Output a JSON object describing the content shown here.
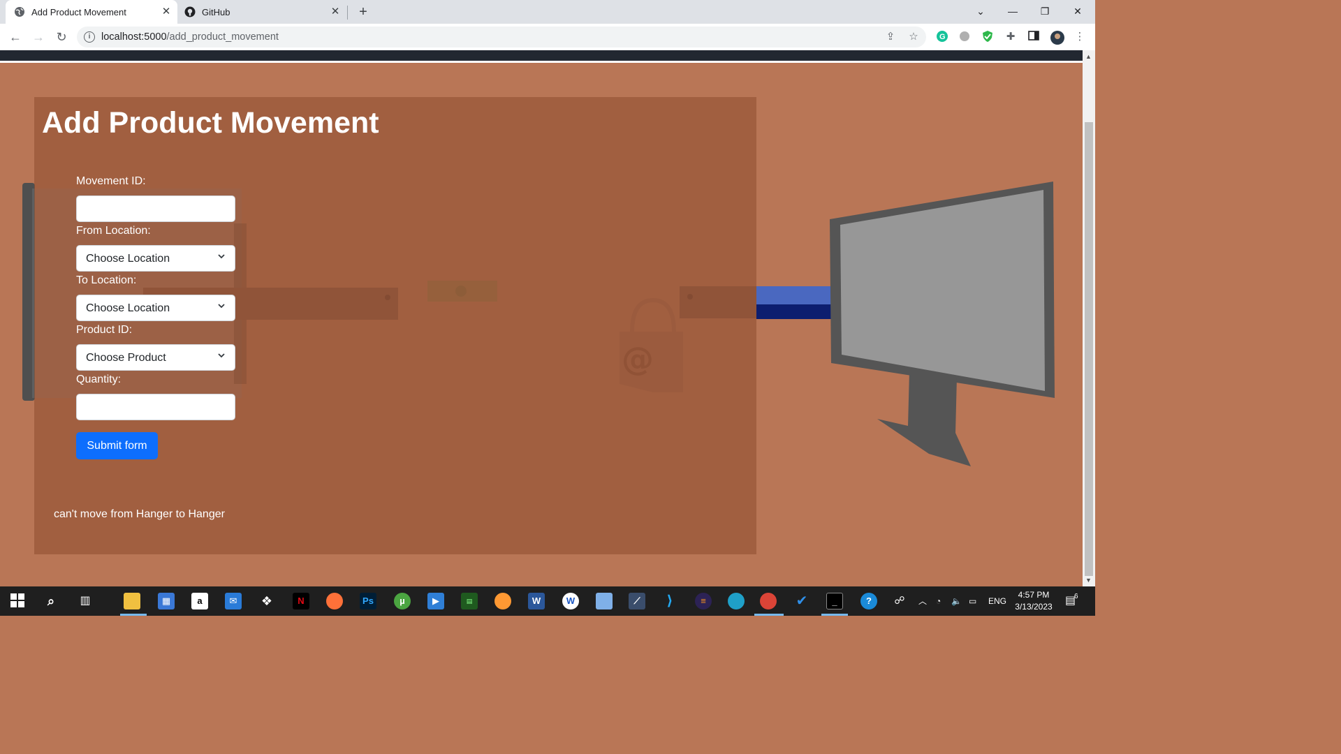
{
  "browser": {
    "tabs": [
      {
        "title": "Add Product Movement",
        "active": true
      },
      {
        "title": "GitHub",
        "active": false
      }
    ],
    "url_host": "localhost:5000",
    "url_path": "/add_product_movement"
  },
  "page": {
    "title": "Add Product Movement",
    "form": {
      "movement_id_label": "Movement ID:",
      "movement_id_value": "",
      "from_location_label": "From Location:",
      "from_location_selected": "Choose Location",
      "to_location_label": "To Location:",
      "to_location_selected": "Choose Location",
      "product_id_label": "Product ID:",
      "product_selected": "Choose Product",
      "quantity_label": "Quantity:",
      "quantity_value": "",
      "submit_label": "Submit form"
    },
    "message": "can't move from Hanger to Hanger"
  },
  "taskbar": {
    "language": "ENG",
    "time": "4:57 PM",
    "date": "3/13/2023",
    "notification_count": "6",
    "apps": [
      "start-icon",
      "search-icon",
      "task-view-icon",
      "file-explorer-icon",
      "store-icon",
      "amazon-icon",
      "mail-icon",
      "dropbox-icon",
      "netflix-icon",
      "firefox-icon",
      "photoshop-icon",
      "utorrent-icon",
      "video-icon",
      "terminal-green-icon",
      "sublime-icon",
      "word-icon",
      "app-w-icon",
      "box-icon",
      "db-icon",
      "vscode-icon",
      "eclipse-icon",
      "edge-icon",
      "chrome-icon",
      "todo-icon",
      "cmd-icon",
      "help-icon"
    ]
  },
  "colors": {
    "page_bg": "#b97656",
    "panel_bg": "#9b5b3e",
    "button": "#0d6efd",
    "monitor": "#555555",
    "sleeve_blue": "#4a68c0",
    "sleeve_dark": "#0d1e6f"
  }
}
